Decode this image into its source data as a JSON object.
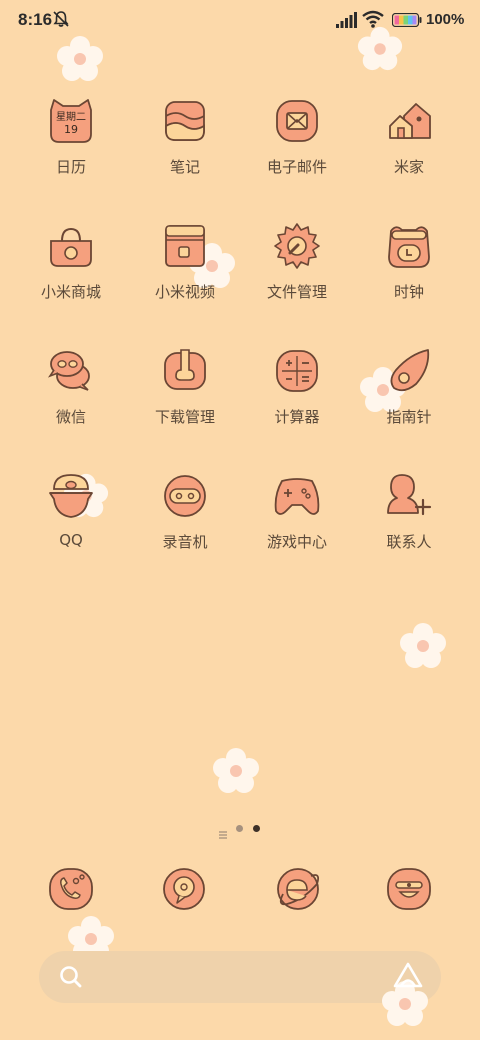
{
  "status": {
    "time": "8:16",
    "battery": "100%",
    "icons": [
      "bell-muted-icon",
      "signal-icon",
      "wifi-icon",
      "battery-icon"
    ]
  },
  "apps": [
    {
      "label": "日历",
      "icon": "calendar-icon",
      "cal_top": "星期二",
      "cal_day": "19"
    },
    {
      "label": "笔记",
      "icon": "notes-icon"
    },
    {
      "label": "电子邮件",
      "icon": "email-icon"
    },
    {
      "label": "米家",
      "icon": "mi-home-icon"
    },
    {
      "label": "小米商城",
      "icon": "mi-store-icon"
    },
    {
      "label": "小米视频",
      "icon": "mi-video-icon"
    },
    {
      "label": "文件管理",
      "icon": "file-manager-icon"
    },
    {
      "label": "时钟",
      "icon": "clock-icon"
    },
    {
      "label": "微信",
      "icon": "wechat-icon"
    },
    {
      "label": "下载管理",
      "icon": "download-manager-icon"
    },
    {
      "label": "计算器",
      "icon": "calculator-icon"
    },
    {
      "label": "指南针",
      "icon": "compass-icon"
    },
    {
      "label": "QQ",
      "icon": "qq-icon"
    },
    {
      "label": "录音机",
      "icon": "recorder-icon"
    },
    {
      "label": "游戏中心",
      "icon": "game-center-icon"
    },
    {
      "label": "联系人",
      "icon": "contacts-icon"
    }
  ],
  "pager": {
    "pages": 3,
    "active": 2
  },
  "dock": [
    "phone-icon",
    "messages-icon",
    "browser-icon",
    "camera-icon"
  ],
  "search": {
    "left_icon": "search-icon",
    "right_icon": "assistant-icon"
  },
  "colors": {
    "background": "#FCD9AA",
    "icon_fill": "#F5A07E",
    "icon_stroke": "#6B4634",
    "accent": "#FCD59A",
    "flower": "#FFF6EC",
    "flower_center": "#F9C6B0"
  }
}
